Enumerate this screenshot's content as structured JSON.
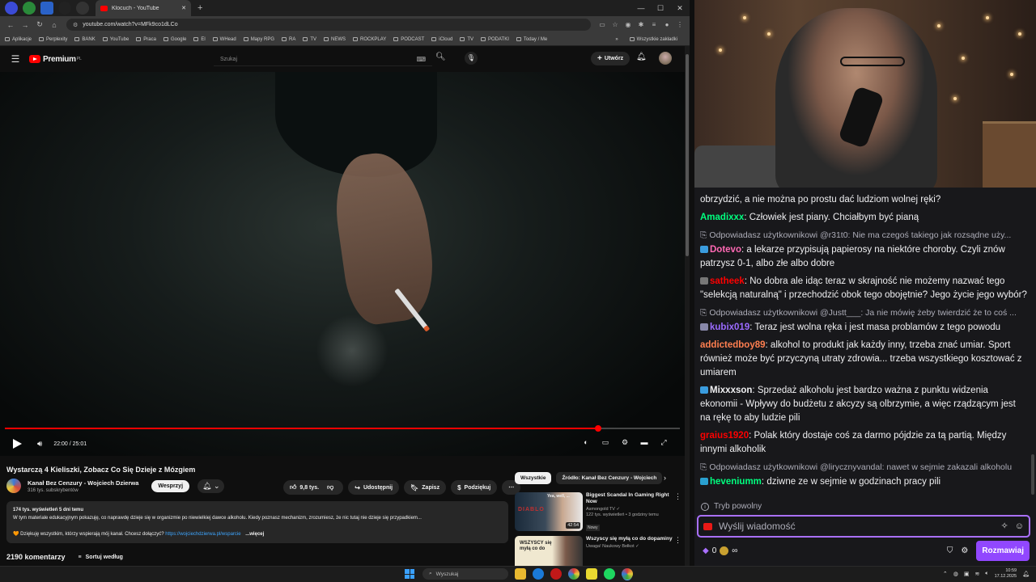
{
  "browser": {
    "tab_title": "Klocuch - YouTube",
    "url": "youtube.com/watch?v=MFk9co1dLCo",
    "bookmarks": [
      "Aplikacje",
      "Perplexity",
      "BANK",
      "YouTube",
      "Praca",
      "Google",
      "El",
      "WHead",
      "Mapy RPG",
      "RA",
      "TV",
      "NEWS",
      "ROCKPLAY",
      "PODCAST",
      "iCloud",
      "TV",
      "PODATKI",
      "Today / Me"
    ],
    "bookmarks_more": "»",
    "all_bookmarks": "Wszystkie zakładki"
  },
  "yt": {
    "logo": "Premium",
    "logo_sup": "PL",
    "search_placeholder": "Szukaj",
    "create": "Utwórz",
    "player": {
      "time": "22:00 / 25:01",
      "progress": 0.879
    },
    "video_title": "Wystarczą 4 Kieliszki, Zobacz Co Się Dzieje z Mózgiem",
    "channel_name": "Kanał Bez Cenzury - Wojciech Dzierwa",
    "channel_subs": "316 tys. subskrybentów",
    "support_label": "Wesprzyj",
    "likes": "9,8 tys.",
    "share": "Udostępnij",
    "save": "Zapisz",
    "thanks": "Podziękuj",
    "desc_stats": "174 tys. wyświetleń  5 dni temu",
    "desc_text": "W tym materiale edukacyjnym pokazuję, co naprawdę dzieje się w organizmie po niewielkiej dawce alkoholu. Kiedy poznasz mechanizm, zrozumiesz, że nic tutaj nie dzieje się przypadkiem...",
    "desc_thanks": "Dziękuję wszystkim, którzy wspierają mój kanał. Chcesz dołączyć?",
    "desc_link": "https://wojciechdzierwa.pl/wsparcie",
    "desc_more": "...więcej",
    "comments_count": "2190 komentarzy",
    "sort_label": "Sortuj według",
    "chips": [
      "Wszystkie",
      "Źródło: Kanał Bez Cenzury - Wojciech"
    ],
    "recs": [
      {
        "title": "Biggest Scandal In Gaming Right Now",
        "channel": "Asmongold TV",
        "views": "122 tys. wyświetleń • 3 godziny temu",
        "badge": "Nowy",
        "duration": "42:54",
        "thumb_text": "Yea, well, ..."
      },
      {
        "title": "Wszyscy się myłą co do dopaminy",
        "channel": "Uwaga! Naukowy Bełkot",
        "views": "",
        "badge": "",
        "duration": "",
        "thumb_text": "WSZYSCY się myłą co do"
      }
    ]
  },
  "chat": {
    "messages": [
      {
        "type": "msg",
        "user": "",
        "color": "#efeff1",
        "text": "obrzydzić, a nie można po prostu dać ludziom wolnej ręki?",
        "badge": ""
      },
      {
        "type": "msg",
        "user": "Amadixxx",
        "color": "#00ff7f",
        "text": "Człowiek jest piany. Chciałbym być pianą",
        "badge": ""
      },
      {
        "type": "reply",
        "text": "Odpowiadasz użytkownikowi @r31t0: Nie ma czegoś takiego jak rozsądne uży..."
      },
      {
        "type": "msg",
        "user": "Dotevo",
        "color": "#ff69b4",
        "text": "a lekarze przypisują papierosy na niektóre choroby. Czyli znów patrzysz 0-1, albo złe albo dobre",
        "badge": "#3a9cde"
      },
      {
        "type": "msg",
        "user": "satheek",
        "color": "#ff0000",
        "text": "No dobra ale idąc teraz w skrajność nie możemy nazwać tego \"selekcją naturalną\" i przechodzić obok tego obojętnie? Jego życie jego wybór?",
        "badge": "#777777"
      },
      {
        "type": "reply",
        "text": "Odpowiadasz użytkownikowi @Justt___: Ja nie mówię żeby twierdzić że to coś ..."
      },
      {
        "type": "msg",
        "user": "kubix019",
        "color": "#9b6bff",
        "text": "Teraz jest wolna ręka i jest masa problamów z tego powodu",
        "badge": "#8888aa"
      },
      {
        "type": "msg",
        "user": "addictedboy89",
        "color": "#ff7f50",
        "text": "alkohol to produkt jak każdy inny, trzeba znać umiar. Sport również może być przyczyną utraty zdrowia... trzeba wszystkiego kosztować z umiarem",
        "badge": ""
      },
      {
        "type": "msg",
        "user": "Mixxxson",
        "color": "#efeff1",
        "text": "Sprzedaż alkoholu jest bardzo ważna z punktu widzenia ekonomii - Wpływy do budżetu z akcyzy są olbrzymie, a więc rządzącym jest na rękę to aby ludzie pili",
        "badge": "#3a9cde"
      },
      {
        "type": "msg",
        "user": "graius1920",
        "color": "#ff0000",
        "text": "Polak który dostaje coś za darmo pójdzie za tą partią. Między innymi alkoholik",
        "badge": ""
      },
      {
        "type": "reply",
        "text": "Odpowiadasz użytkownikowi @lirycznyvandal: nawet w sejmie zakazali alkoholu"
      },
      {
        "type": "msg",
        "user": "heveniumm",
        "color": "#00ff7f",
        "text": "dziwne ze w sejmie w godzinach pracy pili",
        "badge": "#2aa0d0"
      }
    ],
    "slow_mode": "Tryb powolny",
    "input_placeholder": "Wyślij wiadomość",
    "points": "0",
    "infinity": "∞",
    "send_label": "Rozmawiaj"
  },
  "taskbar": {
    "search_placeholder": "Wyszukaj",
    "time": "10:59",
    "date": "17.12.2025"
  }
}
